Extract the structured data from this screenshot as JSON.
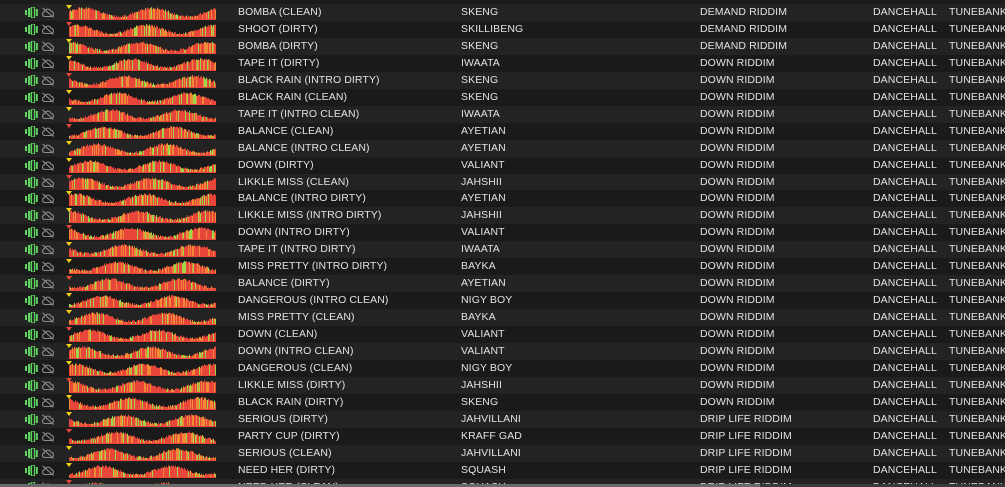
{
  "icons": {
    "status": "vu-meter-icon",
    "stream": "cloud-off-icon"
  },
  "colors": {
    "text": "#e2e2e2",
    "row_even": "#232323",
    "row_odd": "#1a1a1a",
    "wave_red": "#e8463a",
    "wave_orange": "#f08a36",
    "wave_green": "#9ed64a",
    "icon_green": "#5fd35f",
    "marker_yellow": "#f2d21a"
  },
  "tracks": [
    {
      "title": "BOMBA (CLEAN)",
      "artist": "SKENG",
      "album": "DEMAND RIDDIM",
      "genre": "DANCEHALL",
      "label": "TUNEBANK"
    },
    {
      "title": "SHOOT (DIRTY)",
      "artist": "SKILLIBENG",
      "album": "DEMAND RIDDIM",
      "genre": "DANCEHALL",
      "label": "TUNEBANK"
    },
    {
      "title": "BOMBA (DIRTY)",
      "artist": "SKENG",
      "album": "DEMAND RIDDIM",
      "genre": "DANCEHALL",
      "label": "TUNEBANK"
    },
    {
      "title": "TAPE IT (DIRTY)",
      "artist": "IWAATA",
      "album": "DOWN RIDDIM",
      "genre": "DANCEHALL",
      "label": "TUNEBANK"
    },
    {
      "title": "BLACK RAIN (INTRO DIRTY)",
      "artist": "SKENG",
      "album": "DOWN RIDDIM",
      "genre": "DANCEHALL",
      "label": "TUNEBANK"
    },
    {
      "title": "BLACK RAIN (CLEAN)",
      "artist": "SKENG",
      "album": "DOWN RIDDIM",
      "genre": "DANCEHALL",
      "label": "TUNEBANK"
    },
    {
      "title": "TAPE IT (INTRO CLEAN)",
      "artist": "IWAATA",
      "album": "DOWN RIDDIM",
      "genre": "DANCEHALL",
      "label": "TUNEBANK"
    },
    {
      "title": "BALANCE (CLEAN)",
      "artist": "AYETIAN",
      "album": "DOWN RIDDIM",
      "genre": "DANCEHALL",
      "label": "TUNEBANK"
    },
    {
      "title": "BALANCE (INTRO CLEAN)",
      "artist": "AYETIAN",
      "album": "DOWN RIDDIM",
      "genre": "DANCEHALL",
      "label": "TUNEBANK"
    },
    {
      "title": "DOWN (DIRTY)",
      "artist": "VALIANT",
      "album": "DOWN RIDDIM",
      "genre": "DANCEHALL",
      "label": "TUNEBANK"
    },
    {
      "title": "LIKKLE MISS (CLEAN)",
      "artist": "JAHSHII",
      "album": "DOWN RIDDIM",
      "genre": "DANCEHALL",
      "label": "TUNEBANK"
    },
    {
      "title": "BALANCE (INTRO DIRTY)",
      "artist": "AYETIAN",
      "album": "DOWN RIDDIM",
      "genre": "DANCEHALL",
      "label": "TUNEBANK"
    },
    {
      "title": "LIKKLE MISS (INTRO DIRTY)",
      "artist": "JAHSHII",
      "album": "DOWN RIDDIM",
      "genre": "DANCEHALL",
      "label": "TUNEBANK"
    },
    {
      "title": "DOWN (INTRO DIRTY)",
      "artist": "VALIANT",
      "album": "DOWN RIDDIM",
      "genre": "DANCEHALL",
      "label": "TUNEBANK"
    },
    {
      "title": "TAPE IT (INTRO DIRTY)",
      "artist": "IWAATA",
      "album": "DOWN RIDDIM",
      "genre": "DANCEHALL",
      "label": "TUNEBANK"
    },
    {
      "title": "MISS PRETTY (INTRO DIRTY)",
      "artist": "BAYKA",
      "album": "DOWN RIDDIM",
      "genre": "DANCEHALL",
      "label": "TUNEBANK"
    },
    {
      "title": "BALANCE (DIRTY)",
      "artist": "AYETIAN",
      "album": "DOWN RIDDIM",
      "genre": "DANCEHALL",
      "label": "TUNEBANK"
    },
    {
      "title": "DANGEROUS (INTRO CLEAN)",
      "artist": "NIGY BOY",
      "album": "DOWN RIDDIM",
      "genre": "DANCEHALL",
      "label": "TUNEBANK"
    },
    {
      "title": "MISS PRETTY (CLEAN)",
      "artist": "BAYKA",
      "album": "DOWN RIDDIM",
      "genre": "DANCEHALL",
      "label": "TUNEBANK"
    },
    {
      "title": "DOWN (CLEAN)",
      "artist": "VALIANT",
      "album": "DOWN RIDDIM",
      "genre": "DANCEHALL",
      "label": "TUNEBANK"
    },
    {
      "title": "DOWN (INTRO CLEAN)",
      "artist": "VALIANT",
      "album": "DOWN RIDDIM",
      "genre": "DANCEHALL",
      "label": "TUNEBANK"
    },
    {
      "title": "DANGEROUS (CLEAN)",
      "artist": "NIGY BOY",
      "album": "DOWN RIDDIM",
      "genre": "DANCEHALL",
      "label": "TUNEBANK"
    },
    {
      "title": "LIKKLE MISS (DIRTY)",
      "artist": "JAHSHII",
      "album": "DOWN RIDDIM",
      "genre": "DANCEHALL",
      "label": "TUNEBANK"
    },
    {
      "title": "BLACK RAIN (DIRTY)",
      "artist": "SKENG",
      "album": "DOWN RIDDIM",
      "genre": "DANCEHALL",
      "label": "TUNEBANK"
    },
    {
      "title": "SERIOUS (DIRTY)",
      "artist": "JAHVILLANI",
      "album": "DRIP LIFE RIDDIM",
      "genre": "DANCEHALL",
      "label": "TUNEBANK"
    },
    {
      "title": "PARTY CUP (DIRTY)",
      "artist": "KRAFF GAD",
      "album": "DRIP LIFE RIDDIM",
      "genre": "DANCEHALL",
      "label": "TUNEBANK"
    },
    {
      "title": "SERIOUS (CLEAN)",
      "artist": "JAHVILLANI",
      "album": "DRIP LIFE RIDDIM",
      "genre": "DANCEHALL",
      "label": "TUNEBANK"
    },
    {
      "title": "NEED HER (DIRTY)",
      "artist": "SQUASH",
      "album": "DRIP LIFE RIDDIM",
      "genre": "DANCEHALL",
      "label": "TUNEBANK"
    },
    {
      "title": "NEED HER (CLEAN)",
      "artist": "SQUASH",
      "album": "DRIP LIFE RIDDIM",
      "genre": "DANCEHALL",
      "label": "TUNEBANK"
    }
  ]
}
